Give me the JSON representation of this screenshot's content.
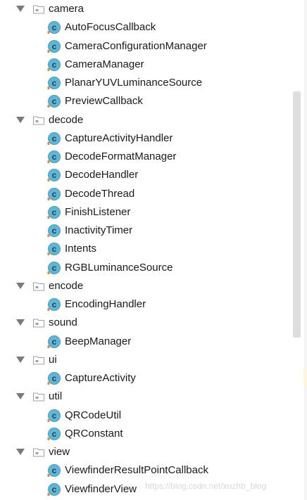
{
  "colors": {
    "class_icon_fill": "#5fb7d6",
    "class_icon_ring": "#4a9bbd",
    "class_icon_accent": "#f08a24",
    "folder_fill": "#9aa3ad",
    "arrow": "#7a7a7a"
  },
  "tree": [
    {
      "kind": "package",
      "label": "camera",
      "expanded": true,
      "icon": "folder-icon"
    },
    {
      "kind": "class",
      "label": "AutoFocusCallback",
      "icon": "class-icon"
    },
    {
      "kind": "class",
      "label": "CameraConfigurationManager",
      "icon": "class-icon"
    },
    {
      "kind": "class",
      "label": "CameraManager",
      "icon": "class-icon"
    },
    {
      "kind": "class",
      "label": "PlanarYUVLuminanceSource",
      "icon": "class-icon"
    },
    {
      "kind": "class",
      "label": "PreviewCallback",
      "icon": "class-icon"
    },
    {
      "kind": "package",
      "label": "decode",
      "expanded": true,
      "icon": "folder-icon"
    },
    {
      "kind": "class",
      "label": "CaptureActivityHandler",
      "icon": "class-icon"
    },
    {
      "kind": "class",
      "label": "DecodeFormatManager",
      "icon": "class-icon"
    },
    {
      "kind": "class",
      "label": "DecodeHandler",
      "icon": "class-icon"
    },
    {
      "kind": "class",
      "label": "DecodeThread",
      "icon": "class-icon"
    },
    {
      "kind": "class",
      "label": "FinishListener",
      "icon": "class-icon"
    },
    {
      "kind": "class",
      "label": "InactivityTimer",
      "icon": "class-icon"
    },
    {
      "kind": "class",
      "label": "Intents",
      "icon": "class-icon"
    },
    {
      "kind": "class",
      "label": "RGBLuminanceSource",
      "icon": "class-icon"
    },
    {
      "kind": "package",
      "label": "encode",
      "expanded": true,
      "icon": "folder-icon"
    },
    {
      "kind": "class",
      "label": "EncodingHandler",
      "icon": "class-icon"
    },
    {
      "kind": "package",
      "label": "sound",
      "expanded": true,
      "icon": "folder-icon"
    },
    {
      "kind": "class",
      "label": "BeepManager",
      "icon": "class-icon"
    },
    {
      "kind": "package",
      "label": "ui",
      "expanded": true,
      "icon": "folder-icon"
    },
    {
      "kind": "class",
      "label": "CaptureActivity",
      "icon": "class-icon"
    },
    {
      "kind": "package",
      "label": "util",
      "expanded": true,
      "icon": "folder-icon"
    },
    {
      "kind": "class",
      "label": "QRCodeUtil",
      "icon": "class-icon"
    },
    {
      "kind": "class",
      "label": "QRConstant",
      "icon": "class-icon"
    },
    {
      "kind": "package",
      "label": "view",
      "expanded": true,
      "icon": "folder-icon"
    },
    {
      "kind": "class",
      "label": "ViewfinderResultPointCallback",
      "icon": "class-icon"
    },
    {
      "kind": "class",
      "label": "ViewfinderView",
      "icon": "class-icon"
    }
  ],
  "watermark": "https://blog.csdn.net/xuzhb_blog"
}
